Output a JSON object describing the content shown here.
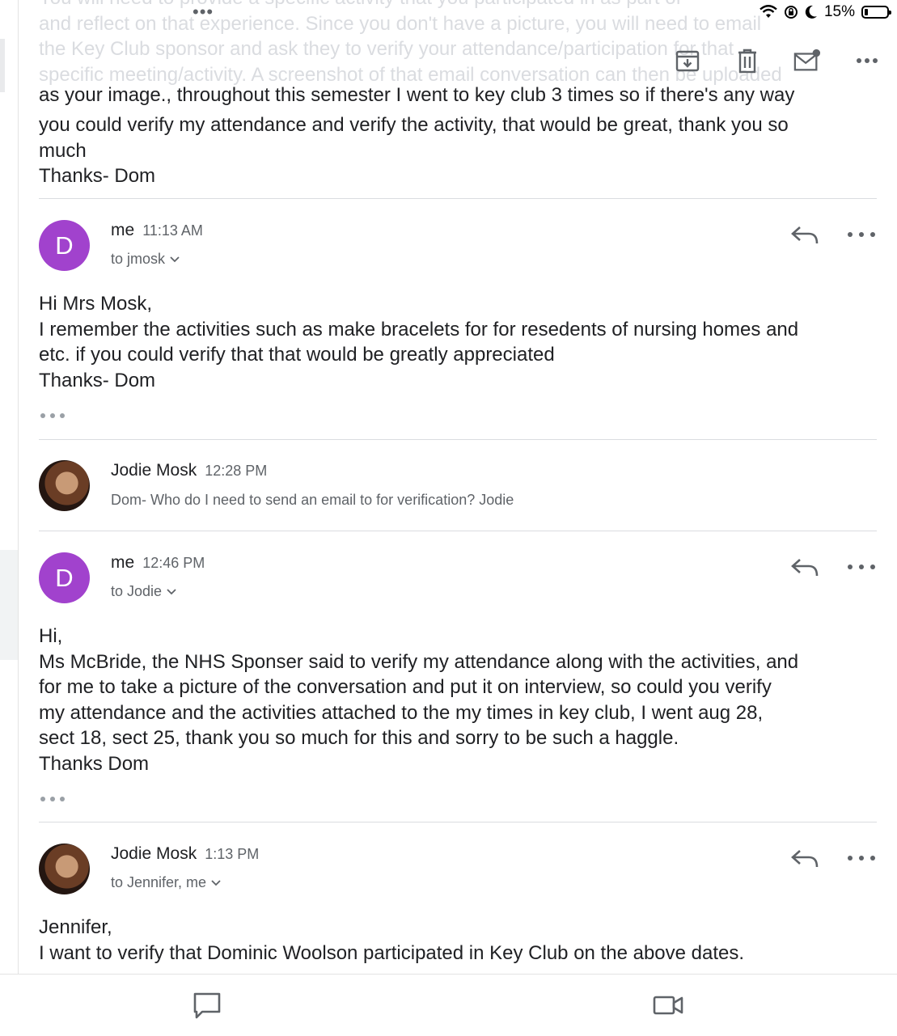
{
  "status_bar": {
    "battery_text": "15%",
    "battery_level": 0.15
  },
  "faded_text": "You will need to provide a specific activity that you participated in as part of\nand reflect on that experience.  Since you don't have a picture, you will need to email\nthe Key Club sponsor and ask they to verify your attendance/participation for that\nspecific meeting/activity.  A screenshot of that email conversation can then be uploaded",
  "toolbar": {
    "archive_icon": "archive-icon",
    "delete_icon": "trash-icon",
    "unread_icon": "mark-unread-icon",
    "more_icon": "more-horizontal-icon"
  },
  "first_message": {
    "clipped_line": "as your image., throughout this semester I went to key club 3 times so if there's any way",
    "body": "you could verify my attendance and verify the activity,  that would be great, thank you so\nmuch\nThanks- Dom"
  },
  "messages": [
    {
      "sender": "me",
      "time": "11:13 AM",
      "avatar_letter": "D",
      "recipient": "to jmosk",
      "body": "Hi Mrs Mosk,\nI remember the activities such as make bracelets for for resedents of nursing homes and\netc. if you could verify that that would be greatly appreciated\nThanks- Dom"
    },
    {
      "sender": "Jodie Mosk",
      "time": "12:28 PM",
      "snippet": "Dom- Who do I need to send an email to for verification? Jodie"
    },
    {
      "sender": "me",
      "time": "12:46 PM",
      "avatar_letter": "D",
      "recipient": "to Jodie",
      "body": "Hi,\nMs McBride, the NHS Sponser said to verify my attendance along with the activities, and\nfor me to take a picture of the conversation and put it on interview, so could you verify\nmy attendance and the activities attached to the my times in key club, I went aug 28,\nsect  18, sect 25, thank you so much for this and sorry to be such a haggle.\nThanks Dom"
    },
    {
      "sender": "Jodie Mosk",
      "time": "1:13 PM",
      "recipient": "to Jennifer, me",
      "body": "Jennifer,\nI want to verify that Dominic Woolson participated in Key Club on the above dates."
    }
  ],
  "bottom_bar": {
    "chat_icon": "chat-icon",
    "video_icon": "video-call-icon"
  }
}
